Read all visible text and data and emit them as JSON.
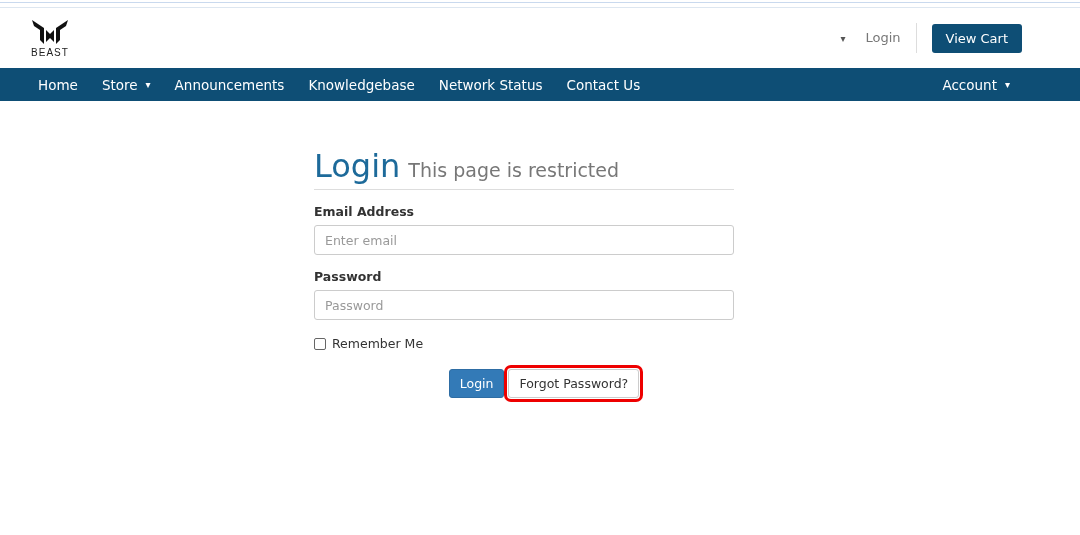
{
  "header": {
    "logo_text": "BEAST",
    "dropdown_caret": "▾",
    "login_link": "Login",
    "cart_button": "View Cart"
  },
  "nav": {
    "items": [
      {
        "label": "Home",
        "caret": false
      },
      {
        "label": "Store",
        "caret": true
      },
      {
        "label": "Announcements",
        "caret": false
      },
      {
        "label": "Knowledgebase",
        "caret": false
      },
      {
        "label": "Network Status",
        "caret": false
      },
      {
        "label": "Contact Us",
        "caret": false
      }
    ],
    "right_item": {
      "label": "Account",
      "caret": true
    }
  },
  "login": {
    "title": "Login",
    "subtitle": "This page is restricted",
    "fields": [
      {
        "label": "Email Address",
        "placeholder": "Enter email"
      },
      {
        "label": "Password",
        "placeholder": "Password"
      }
    ],
    "remember": {
      "label": "Remember Me",
      "checked": false
    },
    "buttons": [
      {
        "label": "Login",
        "kind": "primary",
        "highlighted": false
      },
      {
        "label": "Forgot Password?",
        "kind": "default",
        "highlighted": true
      }
    ]
  }
}
